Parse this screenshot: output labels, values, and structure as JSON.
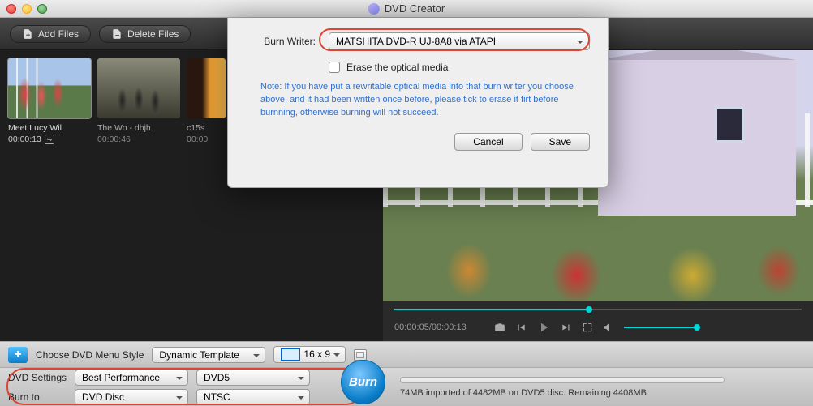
{
  "title": "DVD Creator",
  "toolbar": {
    "add_files": "Add Files",
    "delete_files": "Delete Files"
  },
  "clips": [
    {
      "title": "Meet Lucy Wil",
      "time": "00:00:13"
    },
    {
      "title": "The Wo - dhjh",
      "time": "00:00:46"
    },
    {
      "title": "c15s",
      "time": "00:00"
    }
  ],
  "player": {
    "timecode": "00:00:05/00:00:13"
  },
  "menu_row": {
    "choose": "Choose DVD Menu Style",
    "template": "Dynamic Template",
    "aspect": "16 x 9"
  },
  "settings": {
    "settings_label": "DVD Settings",
    "burn_to_label": "Burn to",
    "perf": "Best Performance",
    "disc_type": "DVD5",
    "dest": "DVD Disc",
    "std": "NTSC"
  },
  "burn": {
    "label": "Burn",
    "status": "74MB imported of 4482MB on DVD5 disc. Remaining 4408MB"
  },
  "dialog": {
    "writer_label": "Burn Writer:",
    "writer_value": "MATSHITA DVD-R   UJ-8A8 via ATAPI",
    "erase_label": "Erase the optical media",
    "note": "Note: If you have put a rewritable optical media into that burn writer you choose above, and it had been written once before, please tick to erase it firt before burnning, otherwise burning will not succeed.",
    "cancel": "Cancel",
    "save": "Save"
  }
}
